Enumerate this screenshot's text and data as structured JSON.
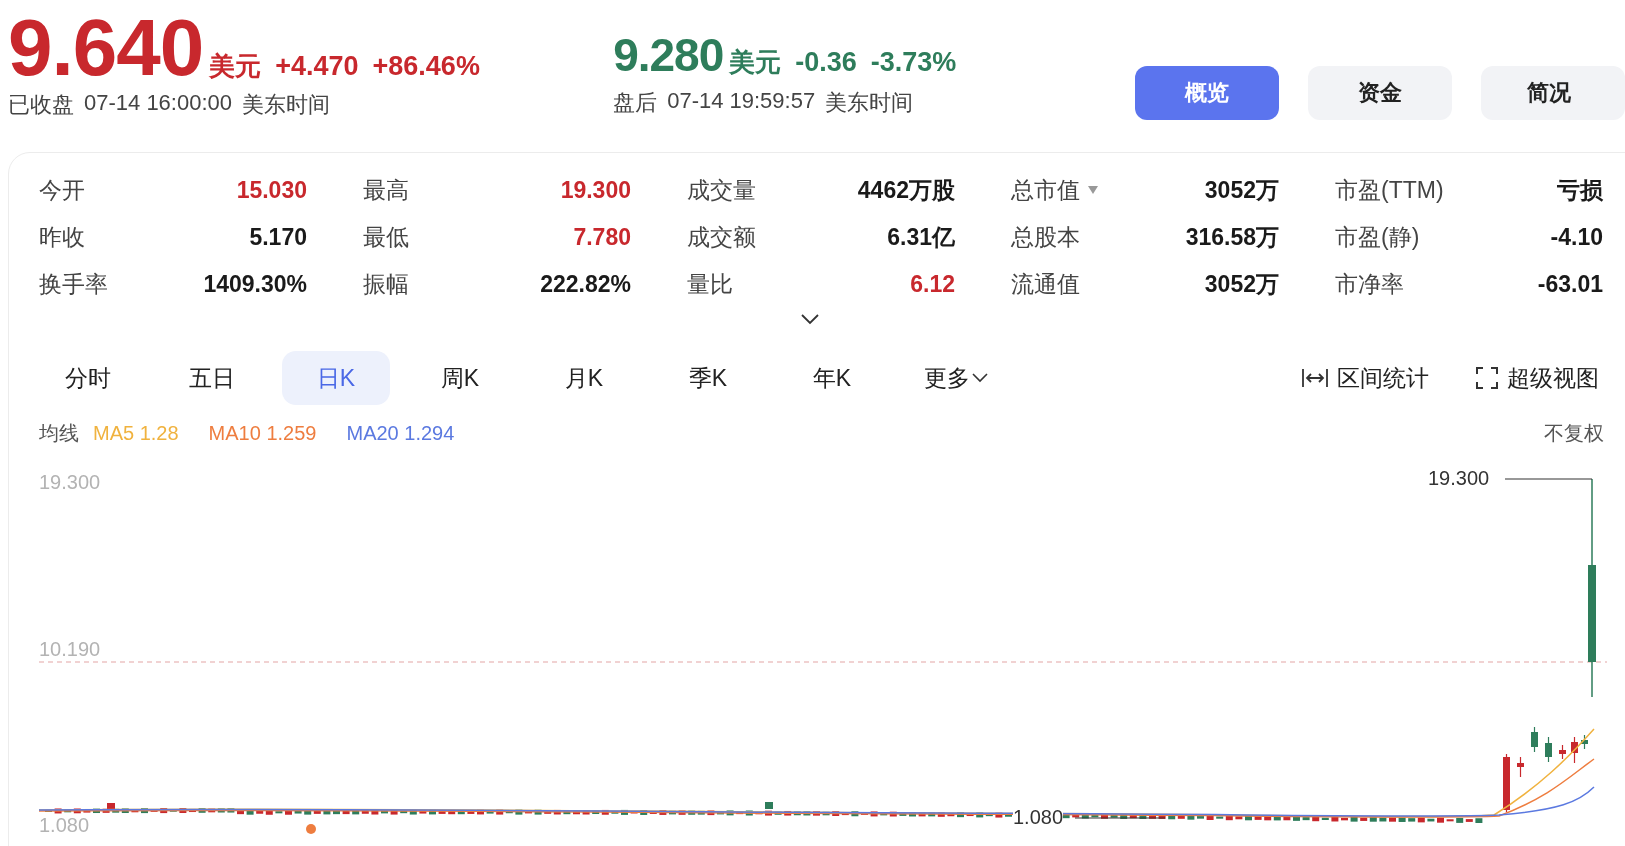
{
  "quote": {
    "price": "9.640",
    "currency": "美元",
    "change": "+4.470",
    "change_pct": "+86.46%",
    "status": "已收盘",
    "datetime": "07-14 16:00:00",
    "timezone": "美东时间"
  },
  "after_hours": {
    "price": "9.280",
    "currency": "美元",
    "change": "-0.36",
    "change_pct": "-3.73%",
    "status": "盘后",
    "datetime": "07-14 19:59:57",
    "timezone": "美东时间"
  },
  "nav_buttons": [
    {
      "label": "概览",
      "selected": true
    },
    {
      "label": "资金",
      "selected": false
    },
    {
      "label": "简况",
      "selected": false
    }
  ],
  "stats": [
    {
      "label": "今开",
      "value": "15.030",
      "color": "#c8282d"
    },
    {
      "label": "最高",
      "value": "19.300",
      "color": "#c8282d"
    },
    {
      "label": "成交量",
      "value": "4462万股",
      "color": "#1a1a1a"
    },
    {
      "label": "总市值",
      "value": "3052万",
      "color": "#1a1a1a",
      "dropdown": true
    },
    {
      "label": "市盈(TTM)",
      "value": "亏损",
      "color": "#1a1a1a"
    },
    {
      "label": "昨收",
      "value": "5.170",
      "color": "#1a1a1a"
    },
    {
      "label": "最低",
      "value": "7.780",
      "color": "#c8282d"
    },
    {
      "label": "成交额",
      "value": "6.31亿",
      "color": "#1a1a1a"
    },
    {
      "label": "总股本",
      "value": "316.58万",
      "color": "#1a1a1a"
    },
    {
      "label": "市盈(静)",
      "value": "-4.10",
      "color": "#1a1a1a"
    },
    {
      "label": "换手率",
      "value": "1409.30%",
      "color": "#1a1a1a"
    },
    {
      "label": "振幅",
      "value": "222.82%",
      "color": "#1a1a1a"
    },
    {
      "label": "量比",
      "value": "6.12",
      "color": "#c8282d"
    },
    {
      "label": "流通值",
      "value": "3052万",
      "color": "#1a1a1a"
    },
    {
      "label": "市净率",
      "value": "-63.01",
      "color": "#1a1a1a"
    }
  ],
  "chart_tabs": [
    {
      "label": "分时",
      "selected": false
    },
    {
      "label": "五日",
      "selected": false
    },
    {
      "label": "日K",
      "selected": true
    },
    {
      "label": "周K",
      "selected": false
    },
    {
      "label": "月K",
      "selected": false
    },
    {
      "label": "季K",
      "selected": false
    },
    {
      "label": "年K",
      "selected": false
    },
    {
      "label": "更多",
      "selected": false,
      "menu": true
    }
  ],
  "chart_tools": [
    {
      "kind": "range",
      "label": "区间统计"
    },
    {
      "kind": "fullscreen",
      "label": "超级视图"
    }
  ],
  "ma_legend": {
    "label": "均线",
    "items": [
      {
        "name": "MA5",
        "value": "1.28",
        "color": "#f0b23e"
      },
      {
        "name": "MA10",
        "value": "1.259",
        "color": "#ee7d3f"
      },
      {
        "name": "MA20",
        "value": "1.294",
        "color": "#5b79e0"
      }
    ],
    "adjustment": "不复权"
  },
  "chart": {
    "y_labels": [
      "19.300",
      "10.190",
      "1.080"
    ],
    "high_label": "19.300",
    "low_label": "1.080"
  }
}
